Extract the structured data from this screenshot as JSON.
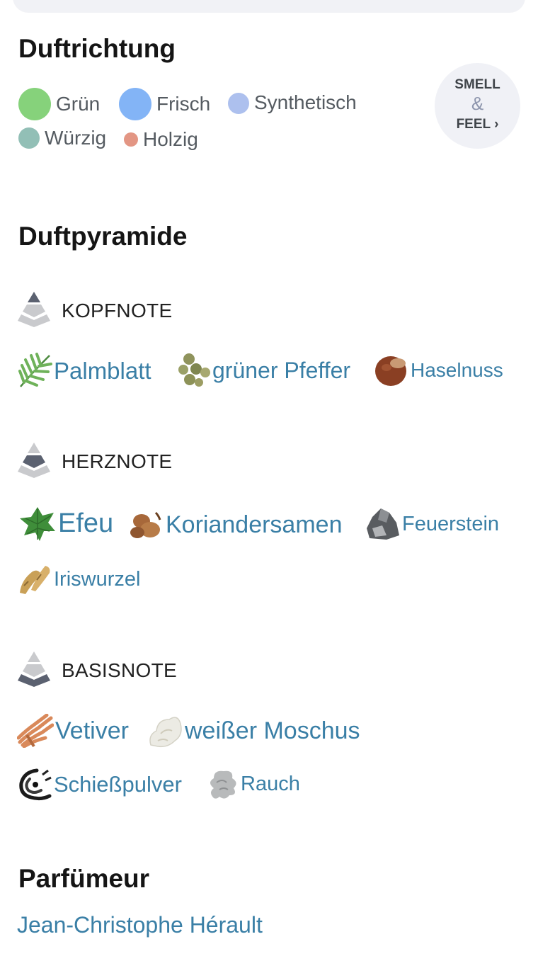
{
  "accords": {
    "title": "Duftrichtung",
    "items": [
      {
        "label": "Grün",
        "color": "#86d27b"
      },
      {
        "label": "Frisch",
        "color": "#83b4f6"
      },
      {
        "label": "Synthetisch",
        "color": "#adc0ee"
      },
      {
        "label": "Würzig",
        "color": "#92bfb6"
      },
      {
        "label": "Holzig",
        "color": "#e39684"
      }
    ],
    "smell_feel": {
      "line1": "SMELL",
      "amp": "&",
      "line2": "FEEL ›"
    }
  },
  "pyramid": {
    "title": "Duftpyramide",
    "top": {
      "label": "KOPFNOTE",
      "notes": [
        {
          "name": "Palmblatt",
          "icon": "palm-leaf-icon"
        },
        {
          "name": "grüner Pfeffer",
          "icon": "green-pepper-icon"
        },
        {
          "name": "Haselnuss",
          "icon": "hazelnut-icon"
        }
      ]
    },
    "heart": {
      "label": "HERZNOTE",
      "notes": [
        {
          "name": "Efeu",
          "icon": "ivy-icon"
        },
        {
          "name": "Koriandersamen",
          "icon": "coriander-seeds-icon"
        },
        {
          "name": "Feuerstein",
          "icon": "flint-icon"
        },
        {
          "name": "Iriswurzel",
          "icon": "iris-root-icon"
        }
      ]
    },
    "base": {
      "label": "BASISNOTE",
      "notes": [
        {
          "name": "Vetiver",
          "icon": "vetiver-icon"
        },
        {
          "name": "weißer Moschus",
          "icon": "white-musk-icon"
        },
        {
          "name": "Schießpulver",
          "icon": "gunpowder-icon"
        },
        {
          "name": "Rauch",
          "icon": "smoke-icon"
        }
      ]
    }
  },
  "perfumer": {
    "title": "Parfümeur",
    "name": "Jean-Christophe Hérault"
  }
}
